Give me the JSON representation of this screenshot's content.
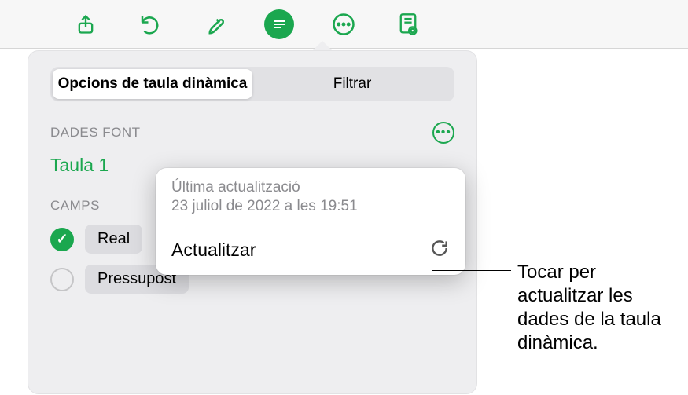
{
  "toolbar": {
    "icons": [
      "share-icon",
      "undo-icon",
      "format-brush-icon",
      "pivot-options-icon",
      "more-icon",
      "document-view-icon"
    ]
  },
  "segmented": {
    "options_label": "Opcions de taula dinàmica",
    "filter_label": "Filtrar"
  },
  "source": {
    "heading": "DADES FONT",
    "table_name": "Taula 1"
  },
  "fields": {
    "heading": "CAMPS",
    "items": [
      {
        "label": "Real",
        "checked": true
      },
      {
        "label": "Pressupost",
        "checked": false
      }
    ]
  },
  "popup": {
    "last_update_title": "Última actualització",
    "last_update_value": "23 juliol de 2022 a les 19:51",
    "action_label": "Actualitzar"
  },
  "callout": {
    "text": "Tocar per actualitzar les dades de la taula dinàmica."
  }
}
